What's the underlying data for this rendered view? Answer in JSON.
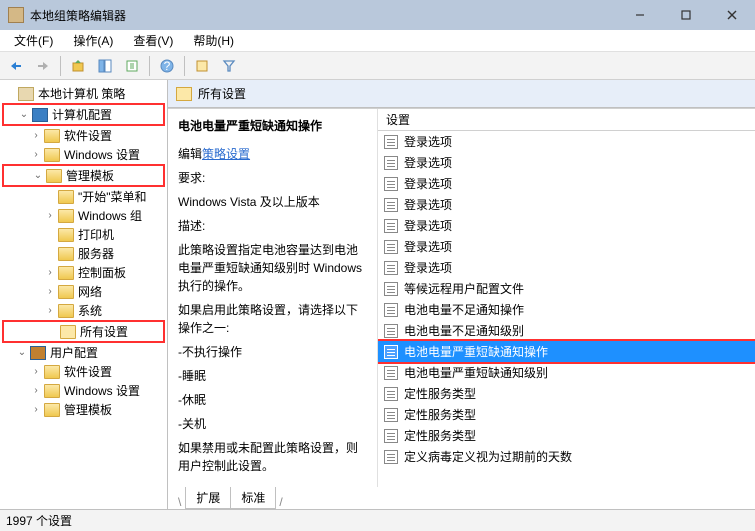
{
  "window": {
    "title": "本地组策略编辑器"
  },
  "menu": {
    "file": "文件(F)",
    "action": "操作(A)",
    "view": "查看(V)",
    "help": "帮助(H)"
  },
  "tree": {
    "root": "本地计算机 策略",
    "computer_config": "计算机配置",
    "software_settings": "软件设置",
    "windows_settings": "Windows 设置",
    "admin_templates": "管理模板",
    "start_menu": "\"开始\"菜单和",
    "windows_components": "Windows 组",
    "printers": "打印机",
    "server": "服务器",
    "control_panel": "控制面板",
    "network": "网络",
    "system": "系统",
    "all_settings": "所有设置",
    "user_config": "用户配置",
    "software_settings2": "软件设置",
    "windows_settings2": "Windows 设置",
    "admin_templates2": "管理模板"
  },
  "pane": {
    "header": "所有设置"
  },
  "detail": {
    "title": "电池电量严重短缺通知操作",
    "edit_prefix": "编辑",
    "edit_link": "策略设置",
    "req_label": "要求:",
    "req_value": "Windows Vista 及以上版本",
    "desc_label": "描述:",
    "desc_body": "此策略设置指定电池容量达到电池电量严重短缺通知级别时 Windows 执行的操作。",
    "enable_body": "如果启用此策略设置，请选择以下操作之一:",
    "opt1": "-不执行操作",
    "opt2": "-睡眠",
    "opt3": "-休眠",
    "opt4": "-关机",
    "disable_body": "如果禁用或未配置此策略设置，则用户控制此设置。"
  },
  "list": {
    "header_col": "设置",
    "items": [
      "登录选项",
      "登录选项",
      "登录选项",
      "登录选项",
      "登录选项",
      "登录选项",
      "登录选项",
      "等候远程用户配置文件",
      "电池电量不足通知操作",
      "电池电量不足通知级别",
      "电池电量严重短缺通知操作",
      "电池电量严重短缺通知级别",
      "定性服务类型",
      "定性服务类型",
      "定性服务类型",
      "定义病毒定义视为过期前的天数"
    ],
    "selected_index": 10
  },
  "tabs": {
    "extended": "扩展",
    "standard": "标准"
  },
  "status": {
    "text": "1997 个设置"
  }
}
